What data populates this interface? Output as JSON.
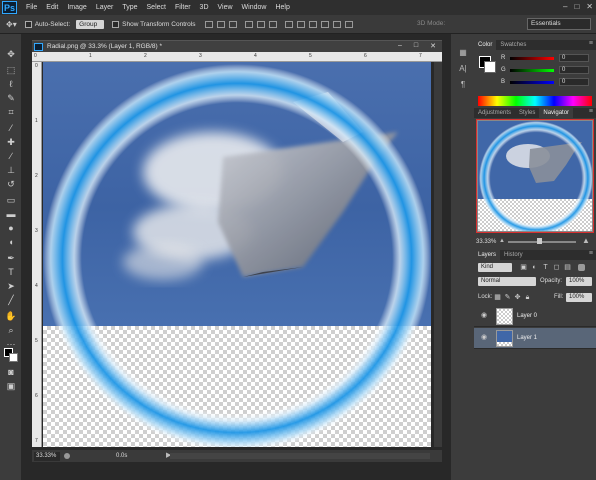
{
  "menubar": {
    "logo": "Ps",
    "items": [
      "File",
      "Edit",
      "Image",
      "Layer",
      "Type",
      "Select",
      "Filter",
      "3D",
      "View",
      "Window",
      "Help"
    ],
    "window_controls": [
      "–",
      "□",
      "✕"
    ]
  },
  "options_bar": {
    "auto_select_label": "Auto-Select:",
    "auto_select_value": "Group",
    "show_transform_label": "Show Transform Controls",
    "mode_3d_label": "3D Mode:",
    "workspace": "Essentials"
  },
  "document": {
    "title": "Radial.png @ 33.3% (Layer 1, RGB/8) *",
    "zoom": "33.33%",
    "time": "0.0s",
    "ruler_top": [
      "0",
      "1",
      "2",
      "3",
      "4",
      "5",
      "6",
      "7"
    ],
    "ruler_left": [
      "0",
      "1",
      "2",
      "3",
      "4",
      "5",
      "6",
      "7"
    ]
  },
  "color_panel": {
    "tabs": [
      "Color",
      "Swatches"
    ],
    "channels": [
      {
        "label": "R",
        "value": "0",
        "color": "#e23b3b"
      },
      {
        "label": "G",
        "value": "0",
        "color": "#3bb43b"
      },
      {
        "label": "B",
        "value": "0",
        "color": "#3b5fe2"
      }
    ]
  },
  "navigator_panel": {
    "tabs": [
      "Adjustments",
      "Styles",
      "Navigator"
    ],
    "zoom": "33.33%"
  },
  "layers_panel": {
    "tabs": [
      "Layers",
      "History"
    ],
    "kind_label": "Kind",
    "blend_mode": "Normal",
    "opacity_label": "Opacity:",
    "opacity_value": "100%",
    "lock_label": "Lock:",
    "fill_label": "Fill:",
    "fill_value": "100%",
    "layers": [
      {
        "name": "Layer 0",
        "selected": false
      },
      {
        "name": "Layer 1",
        "selected": true
      }
    ]
  },
  "colors": {
    "accent": "#31a8ff",
    "ring": "#2aa0e8",
    "sky": "#4067a8",
    "selection": "#596678"
  }
}
